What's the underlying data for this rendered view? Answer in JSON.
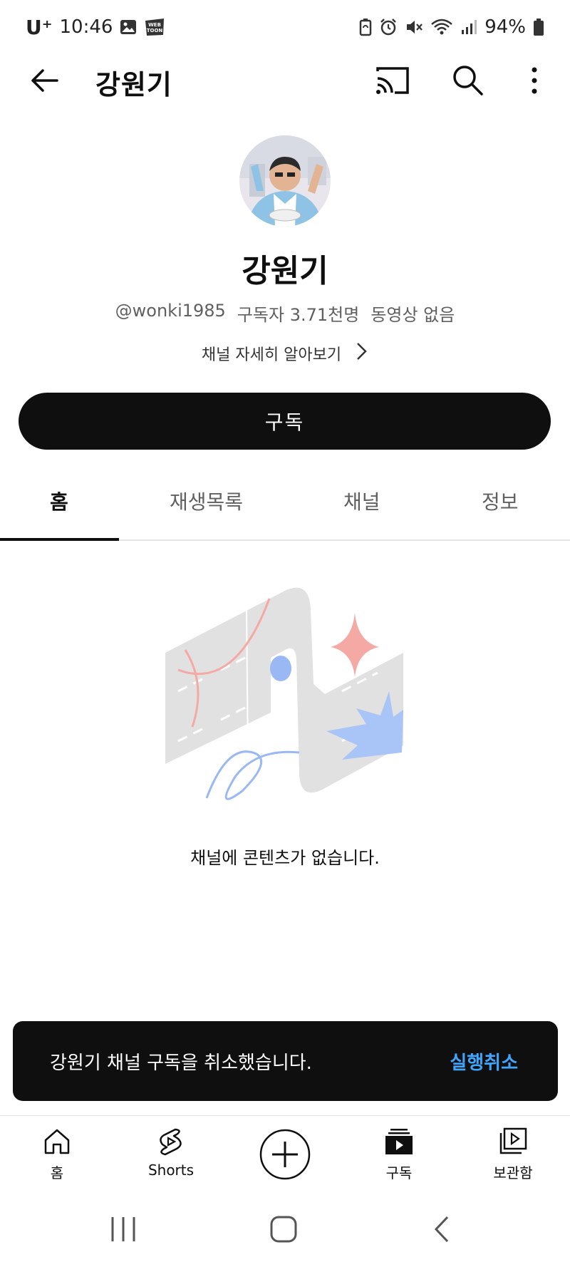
{
  "status_bar": {
    "carrier": "U⁺",
    "time": "10:46",
    "battery": "94%",
    "icons": [
      "image-icon",
      "webtoon-icon",
      "battery-saver-icon",
      "alarm-icon",
      "mute-icon",
      "wifi-icon",
      "signal-icon",
      "battery-icon"
    ],
    "webtoon_label_top": "WEB",
    "webtoon_label_bottom": "TOON"
  },
  "app_bar": {
    "title": "강원기",
    "icons": [
      "back-arrow-icon",
      "cast-icon",
      "search-icon",
      "more-vert-icon"
    ]
  },
  "channel": {
    "name": "강원기",
    "handle": "@wonki1985",
    "subscribers": "구독자 3.71천명",
    "videos": "동영상 없음",
    "more_info": "채널 자세히 알아보기",
    "subscribe_label": "구독"
  },
  "tabs": [
    {
      "label": "홈",
      "active": true
    },
    {
      "label": "재생목록",
      "active": false
    },
    {
      "label": "채널",
      "active": false
    },
    {
      "label": "정보",
      "active": false
    }
  ],
  "empty_state": {
    "message": "채널에 콘텐츠가 없습니다."
  },
  "snackbar": {
    "message": "강원기 채널 구독을 취소했습니다.",
    "action": "실행취소"
  },
  "bottom_nav": {
    "home": "홈",
    "shorts": "Shorts",
    "subscriptions": "구독",
    "library": "보관함"
  },
  "colors": {
    "accent_link": "#3ea6ff",
    "primary": "#0f0f0f"
  }
}
